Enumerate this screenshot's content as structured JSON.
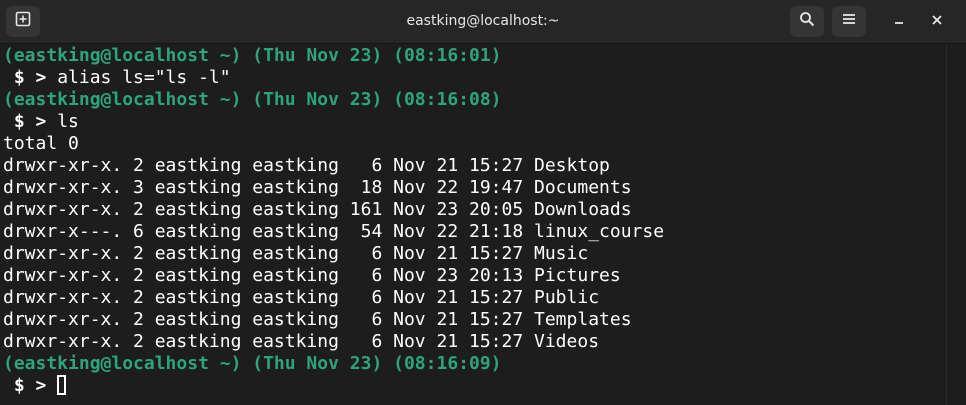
{
  "window": {
    "title": "eastking@localhost:~"
  },
  "colors": {
    "prompt_green": "#2da47a",
    "terminal_bg": "#1d1d1d",
    "titlebar_bg": "#262626",
    "text": "#ffffff"
  },
  "titlebar": {
    "icons": [
      "new-tab-icon",
      "search-icon",
      "hamburger-menu-icon",
      "minimize-icon",
      "close-icon"
    ]
  },
  "terminal": {
    "lines": [
      {
        "kind": "prompt",
        "text": "(eastking@localhost ~) (Thu Nov 23) (08:16:01)"
      },
      {
        "kind": "command",
        "symbol": " $ > ",
        "text": "alias ls=\"ls -l\""
      },
      {
        "kind": "prompt",
        "text": "(eastking@localhost ~) (Thu Nov 23) (08:16:08)"
      },
      {
        "kind": "command",
        "symbol": " $ > ",
        "text": "ls"
      },
      {
        "kind": "output",
        "text": "total 0"
      },
      {
        "kind": "output",
        "text": "drwxr-xr-x. 2 eastking eastking   6 Nov 21 15:27 Desktop"
      },
      {
        "kind": "output",
        "text": "drwxr-xr-x. 3 eastking eastking  18 Nov 22 19:47 Documents"
      },
      {
        "kind": "output",
        "text": "drwxr-xr-x. 2 eastking eastking 161 Nov 23 20:05 Downloads"
      },
      {
        "kind": "output",
        "text": "drwxr-x---. 6 eastking eastking  54 Nov 22 21:18 linux_course"
      },
      {
        "kind": "output",
        "text": "drwxr-xr-x. 2 eastking eastking   6 Nov 21 15:27 Music"
      },
      {
        "kind": "output",
        "text": "drwxr-xr-x. 2 eastking eastking   6 Nov 23 20:13 Pictures"
      },
      {
        "kind": "output",
        "text": "drwxr-xr-x. 2 eastking eastking   6 Nov 21 15:27 Public"
      },
      {
        "kind": "output",
        "text": "drwxr-xr-x. 2 eastking eastking   6 Nov 21 15:27 Templates"
      },
      {
        "kind": "output",
        "text": "drwxr-xr-x. 2 eastking eastking   6 Nov 21 15:27 Videos"
      },
      {
        "kind": "prompt",
        "text": "(eastking@localhost ~) (Thu Nov 23) (08:16:09)"
      },
      {
        "kind": "input",
        "symbol": " $ > ",
        "text": ""
      }
    ]
  }
}
